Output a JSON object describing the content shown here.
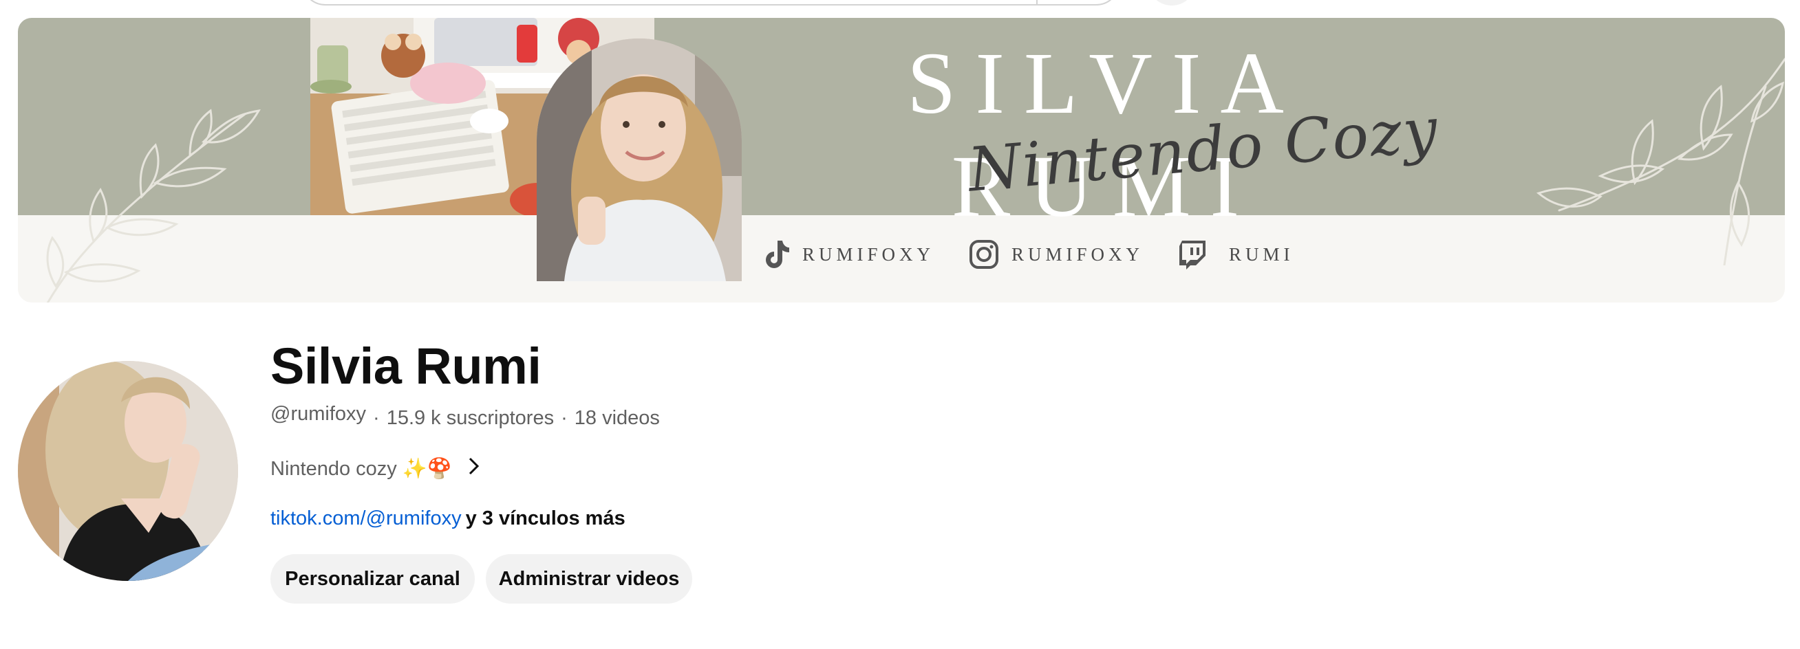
{
  "banner": {
    "title": "SILVIA RUMI",
    "subtitle": "Nintendo Cozy",
    "socials": [
      {
        "icon": "tiktok-icon",
        "label": "RUMIFOXY"
      },
      {
        "icon": "instagram-icon",
        "label": "RUMIFOXY"
      },
      {
        "icon": "twitch-icon",
        "label": "RUMI"
      }
    ]
  },
  "channel": {
    "name": "Silvia Rumi",
    "handle": "@rumifoxy",
    "separator": "·",
    "subscribers": "15.9 k suscriptores",
    "videos": "18 videos",
    "description": "Nintendo cozy ✨🍄",
    "link": "tiktok.com/@rumifoxy",
    "more_links": "y 3 vínculos más"
  },
  "actions": {
    "customize": "Personalizar canal",
    "manage": "Administrar videos"
  },
  "colors": {
    "banner_sage": "#b0b3a3",
    "banner_cream": "#f7f6f3",
    "link_blue": "#065fd4",
    "button_bg": "#f2f2f2"
  }
}
